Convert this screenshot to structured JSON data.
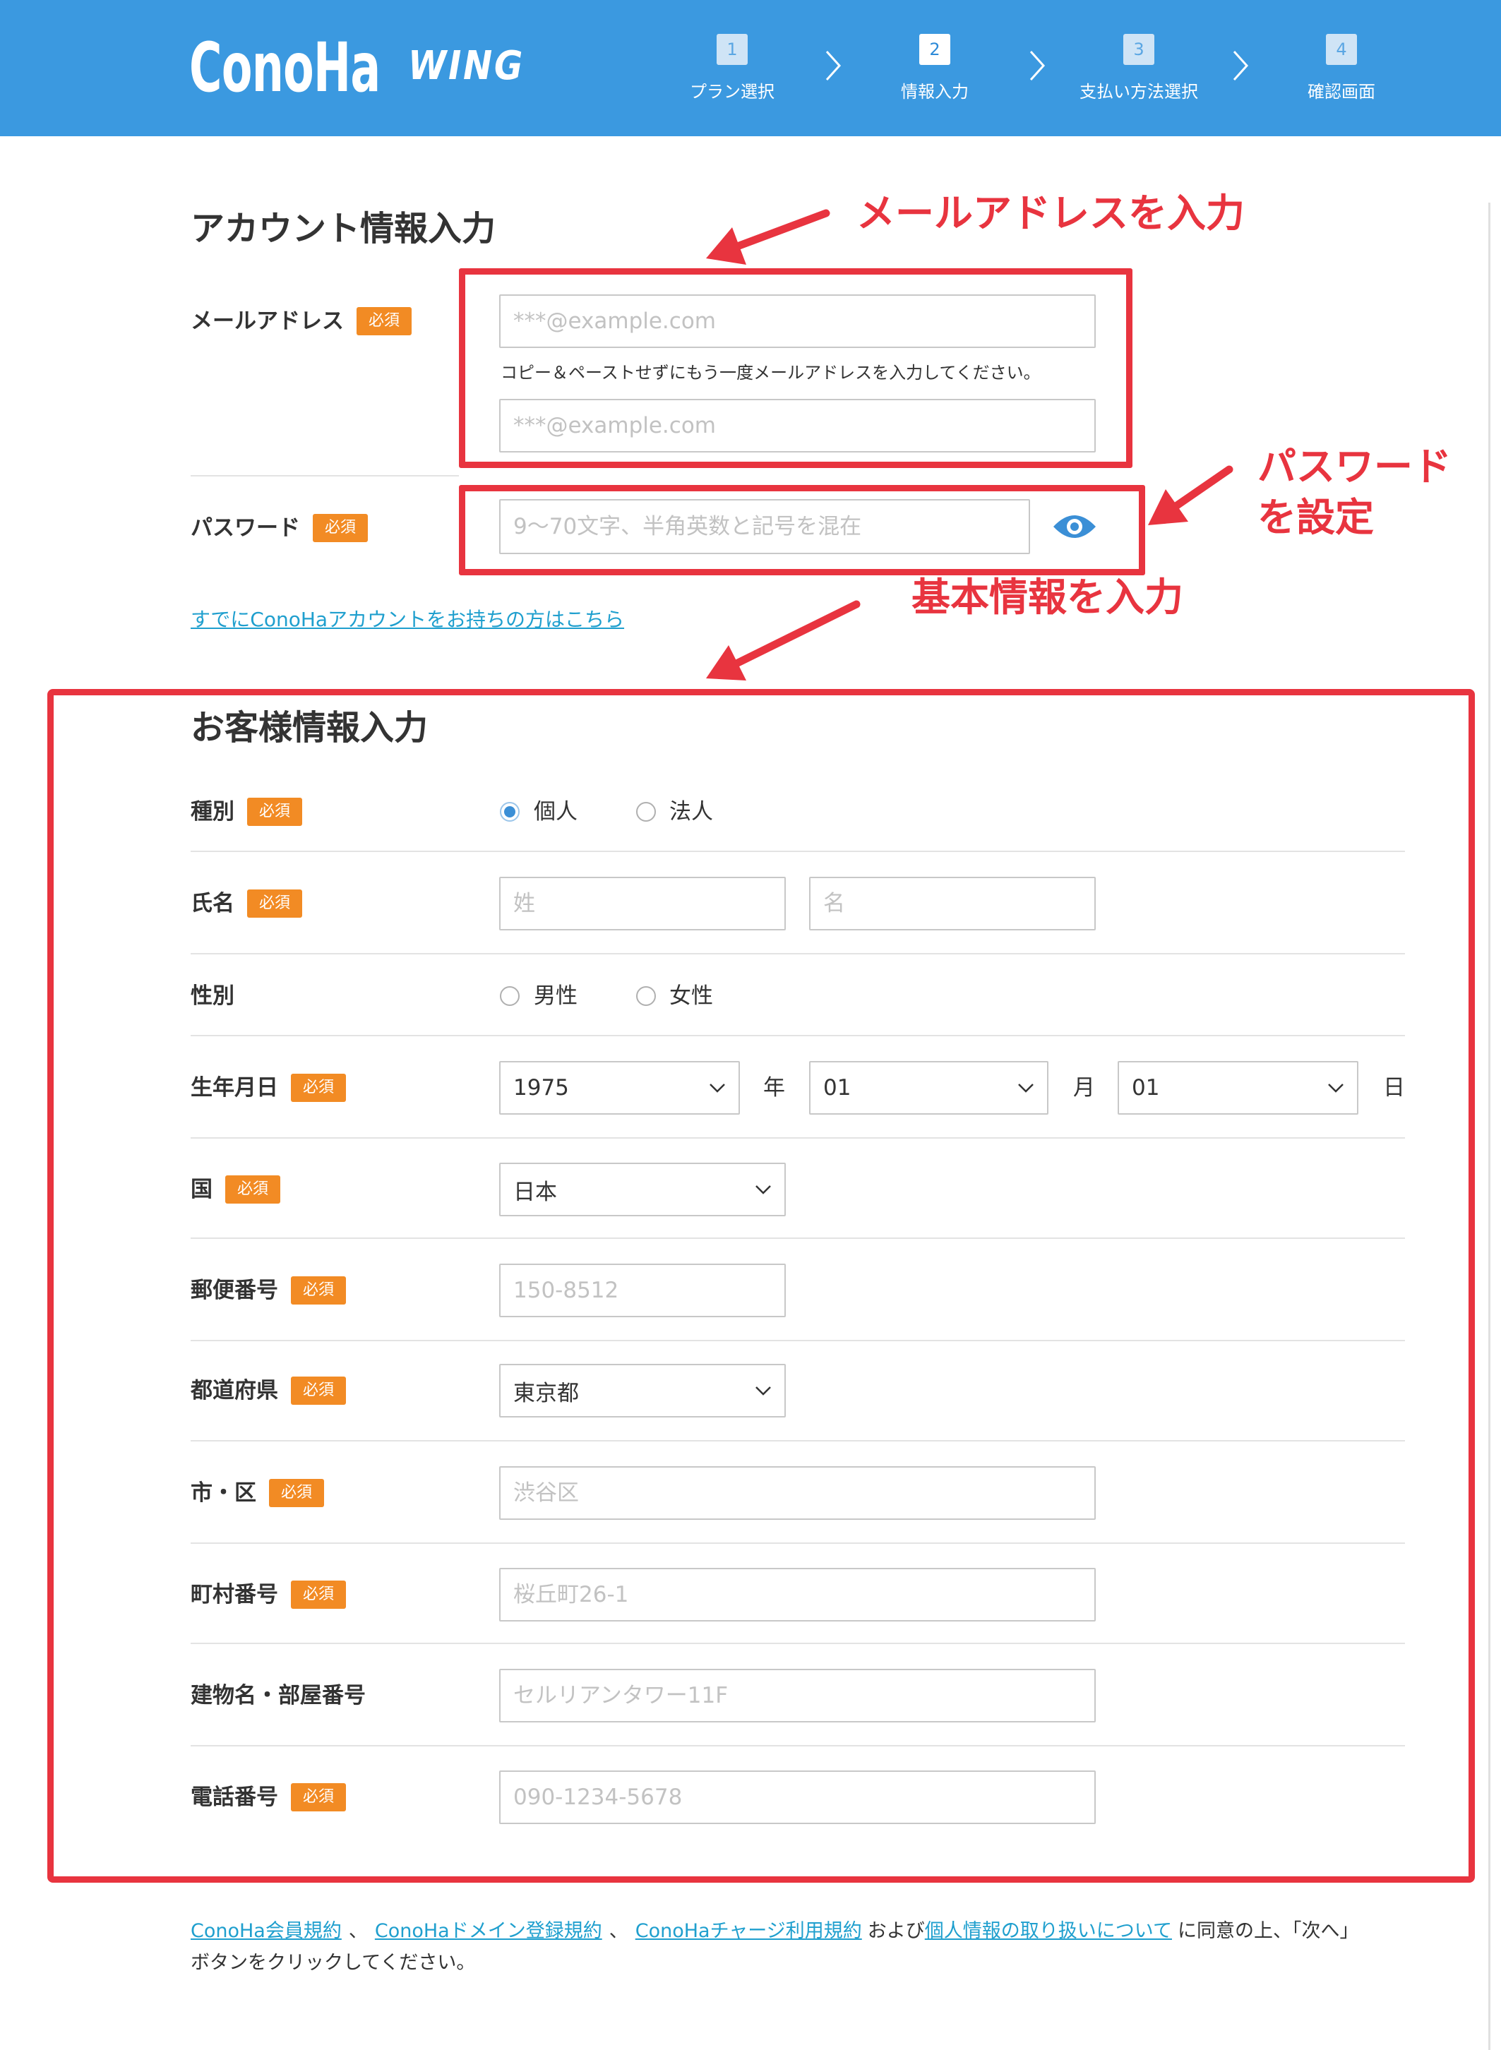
{
  "colors": {
    "brand": "#3b99e0",
    "badge": "#f28b24",
    "link": "#1f9fce",
    "annotation": "#e8343f",
    "accent": "#3b8fd6"
  },
  "header": {
    "logo": {
      "main": "ConoHa",
      "sub": "WING"
    },
    "steps": [
      {
        "number": "1",
        "label": "プラン選択",
        "active": false
      },
      {
        "number": "2",
        "label": "情報入力",
        "active": true
      },
      {
        "number": "3",
        "label": "支払い方法選択",
        "active": false
      },
      {
        "number": "4",
        "label": "確認画面",
        "active": false
      }
    ]
  },
  "required_badge": "必須",
  "account": {
    "title": "アカウント情報入力",
    "email": {
      "label": "メールアドレス",
      "required": true,
      "value": "",
      "placeholder": "***@example.com",
      "confirm_note": "コピー＆ペーストせずにもう一度メールアドレスを入力してください。",
      "confirm_value": "",
      "confirm_placeholder": "***@example.com"
    },
    "password": {
      "label": "パスワード",
      "required": true,
      "value": "",
      "placeholder": "9〜70文字、半角英数と記号を混在",
      "toggle_icon": "eye-icon"
    },
    "existing_account_link": "すでにConoHaアカウントをお持ちの方はこちら"
  },
  "customer": {
    "title": "お客様情報入力",
    "type": {
      "label": "種別",
      "required": true,
      "options": [
        {
          "label": "個人",
          "checked": true
        },
        {
          "label": "法人",
          "checked": false
        }
      ]
    },
    "name": {
      "label": "氏名",
      "required": true,
      "last_value": "",
      "last_placeholder": "姓",
      "first_value": "",
      "first_placeholder": "名"
    },
    "gender": {
      "label": "性別",
      "required": false,
      "options": [
        {
          "label": "男性",
          "checked": false
        },
        {
          "label": "女性",
          "checked": false
        }
      ]
    },
    "birthdate": {
      "label": "生年月日",
      "required": true,
      "year": "1975",
      "year_suffix": "年",
      "month": "01",
      "month_suffix": "月",
      "day": "01",
      "day_suffix": "日"
    },
    "country": {
      "label": "国",
      "required": true,
      "value": "日本"
    },
    "postal_code": {
      "label": "郵便番号",
      "required": true,
      "value": "",
      "placeholder": "150-8512"
    },
    "prefecture": {
      "label": "都道府県",
      "required": true,
      "value": "東京都"
    },
    "city": {
      "label": "市・区",
      "required": true,
      "value": "",
      "placeholder": "渋谷区"
    },
    "town": {
      "label": "町村番号",
      "required": true,
      "value": "",
      "placeholder": "桜丘町26-1"
    },
    "building": {
      "label": "建物名・部屋番号",
      "required": false,
      "value": "",
      "placeholder": "セルリアンタワー11F"
    },
    "phone": {
      "label": "電話番号",
      "required": true,
      "value": "",
      "placeholder": "090-1234-5678"
    }
  },
  "agreement": {
    "links": [
      "ConoHa会員規約",
      "ConoHaドメイン登録規約",
      "ConoHaチャージ利用規約",
      "個人情報の取り扱いについて"
    ],
    "separator": "、",
    "and_text": "および",
    "tail_text": "に同意の上、「次へ」",
    "line2": "ボタンをクリックしてください。"
  },
  "annotations": {
    "email": "メールアドレスを入力",
    "password": [
      "パスワード",
      "を設定"
    ],
    "basic_info": "基本情報を入力"
  }
}
